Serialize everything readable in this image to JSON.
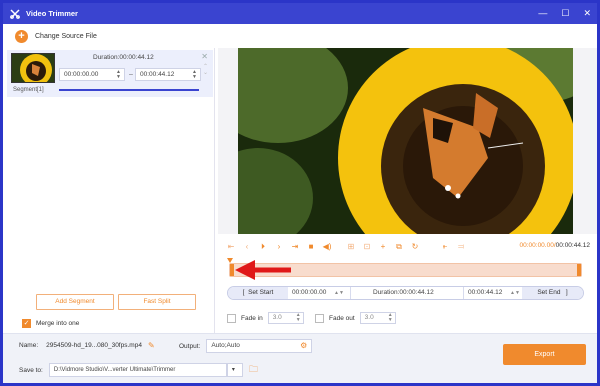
{
  "window": {
    "title": "Video Trimmer",
    "controls": {
      "minimize": "—",
      "maximize": "☐",
      "close": "✕"
    }
  },
  "header": {
    "change_source_label": "Change Source File"
  },
  "segment": {
    "duration": "Duration:00:00:44.12",
    "start": "00:00:00.00",
    "end": "00:00:44.12",
    "label": "Segment[1]"
  },
  "left_buttons": {
    "add_segment": "Add Segment",
    "fast_split": "Fast Split"
  },
  "merge": {
    "label": "Merge into one",
    "checked": true
  },
  "player": {
    "current_time": "00:00:00.00",
    "total_time": "00:00:44.12",
    "icons": [
      "skip-start-icon",
      "prev-frame-icon",
      "play-icon",
      "next-frame-icon",
      "skip-end-icon",
      "stop-icon",
      "volume-icon",
      "split-icon",
      "crop-icon",
      "add-icon",
      "copy-icon",
      "reset-icon",
      "set-start-icon",
      "set-end-icon"
    ]
  },
  "trim": {
    "set_start_label": "Set Start",
    "start_value": "00:00:00.00",
    "duration": "Duration:00:00:44.12",
    "end_value": "00:00:44.12",
    "set_end_label": "Set End"
  },
  "fade": {
    "fade_in_label": "Fade in",
    "fade_in_value": "3.0",
    "fade_out_label": "Fade out",
    "fade_out_value": "3.0"
  },
  "bottom": {
    "name_label": "Name:",
    "name_value": "2954509-hd_19...080_30fps.mp4",
    "output_label": "Output:",
    "output_value": "Auto;Auto",
    "save_label": "Save to:",
    "save_value": "D:\\Vidmore Studio\\V...verter Ultimate\\Trimmer",
    "export_label": "Export"
  },
  "colors": {
    "accent": "#f08a2d",
    "title_bar": "#3a44d0",
    "primary": "#3a44d0"
  }
}
